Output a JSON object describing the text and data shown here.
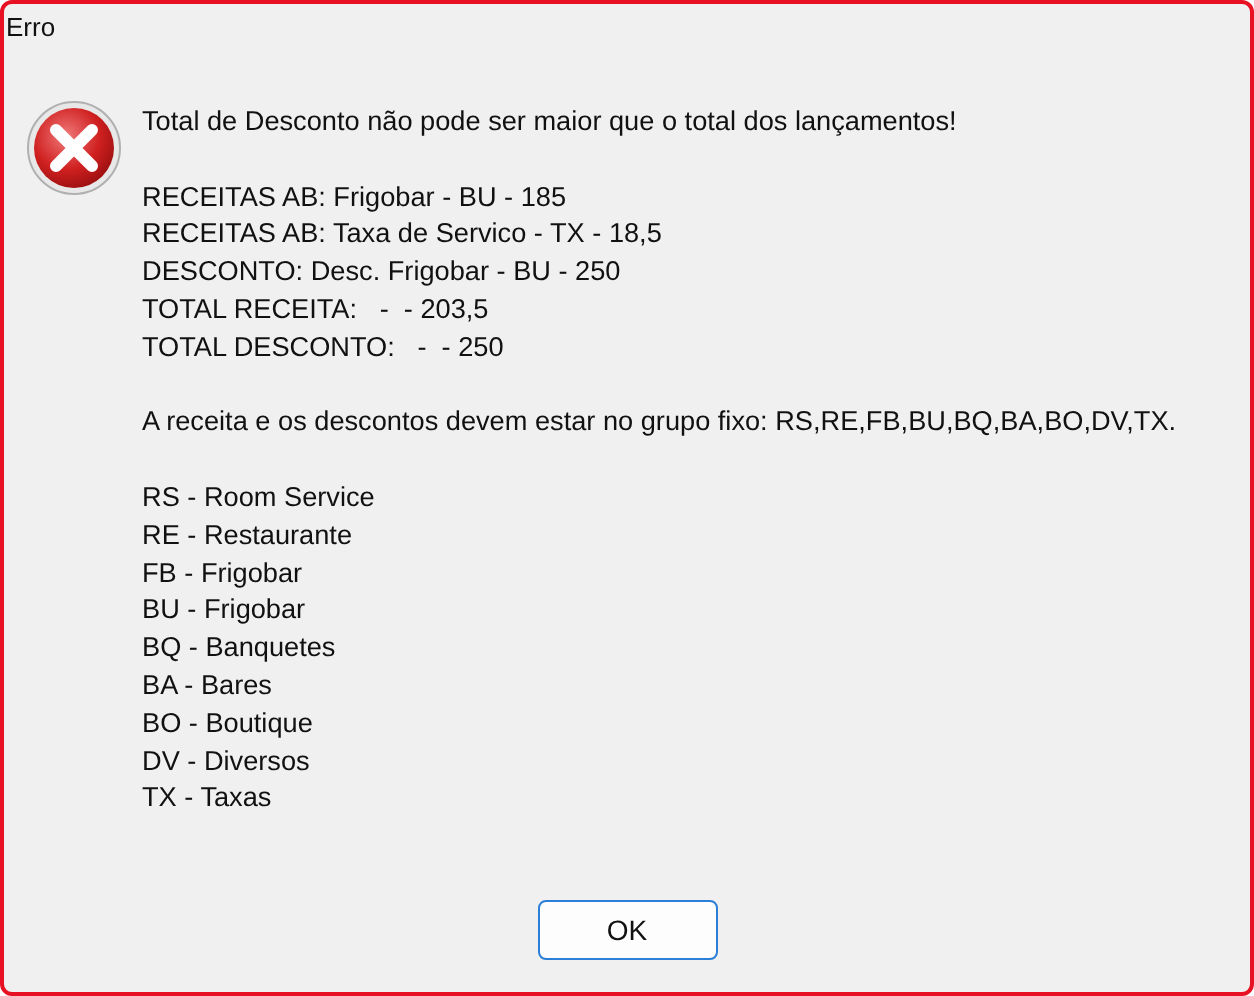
{
  "window": {
    "title": "Erro"
  },
  "message": {
    "paragraphs": [
      {
        "lines": [
          "Total de Desconto não pode ser maior que o total dos lançamentos!"
        ]
      },
      {
        "lines": [
          "RECEITAS AB: Frigobar - BU - 185",
          "RECEITAS AB: Taxa de Servico - TX - 18,5",
          "DESCONTO: Desc. Frigobar - BU - 250",
          "TOTAL RECEITA:   -  - 203,5",
          "TOTAL DESCONTO:   -  - 250"
        ]
      },
      {
        "lines": [
          "A receita e os descontos devem estar no grupo fixo: RS,RE,FB,BU,BQ,BA,BO,DV,TX."
        ]
      },
      {
        "lines": [
          "RS - Room Service",
          "RE - Restaurante",
          "FB - Frigobar",
          "BU - Frigobar",
          "BQ - Banquetes",
          "BA - Bares",
          "BO - Boutique",
          "DV - Diversos",
          "TX - Taxas"
        ]
      }
    ]
  },
  "buttons": [
    "OK"
  ]
}
